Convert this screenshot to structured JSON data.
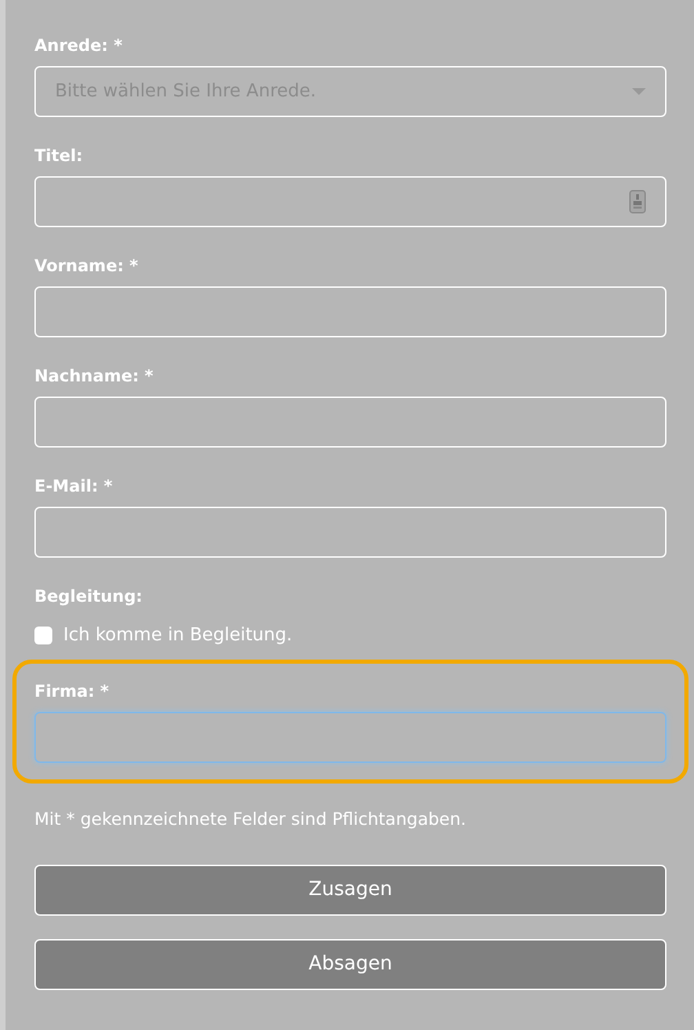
{
  "fields": [
    {
      "kind": "select",
      "label": "Anrede: *",
      "placeholder": "Bitte wählen Sie Ihre Anrede.",
      "focused": false,
      "highlighted": false
    },
    {
      "kind": "text",
      "label": "Titel:",
      "autofill_icon": true,
      "focused": false,
      "highlighted": false
    },
    {
      "kind": "text",
      "label": "Vorname: *",
      "focused": false,
      "highlighted": false
    },
    {
      "kind": "text",
      "label": "Nachname: *",
      "focused": false,
      "highlighted": false
    },
    {
      "kind": "text",
      "label": "E-Mail: *",
      "focused": false,
      "highlighted": false
    },
    {
      "kind": "checkbox",
      "label": "Begleitung:",
      "option": "Ich komme in Begleitung.",
      "checked": false,
      "highlighted": false
    },
    {
      "kind": "text",
      "label": "Firma: *",
      "focused": true,
      "highlighted": true
    }
  ],
  "note": "Mit * gekennzeichnete Felder sind Pflichtangaben.",
  "buttons": [
    "Zusagen",
    "Absagen"
  ]
}
